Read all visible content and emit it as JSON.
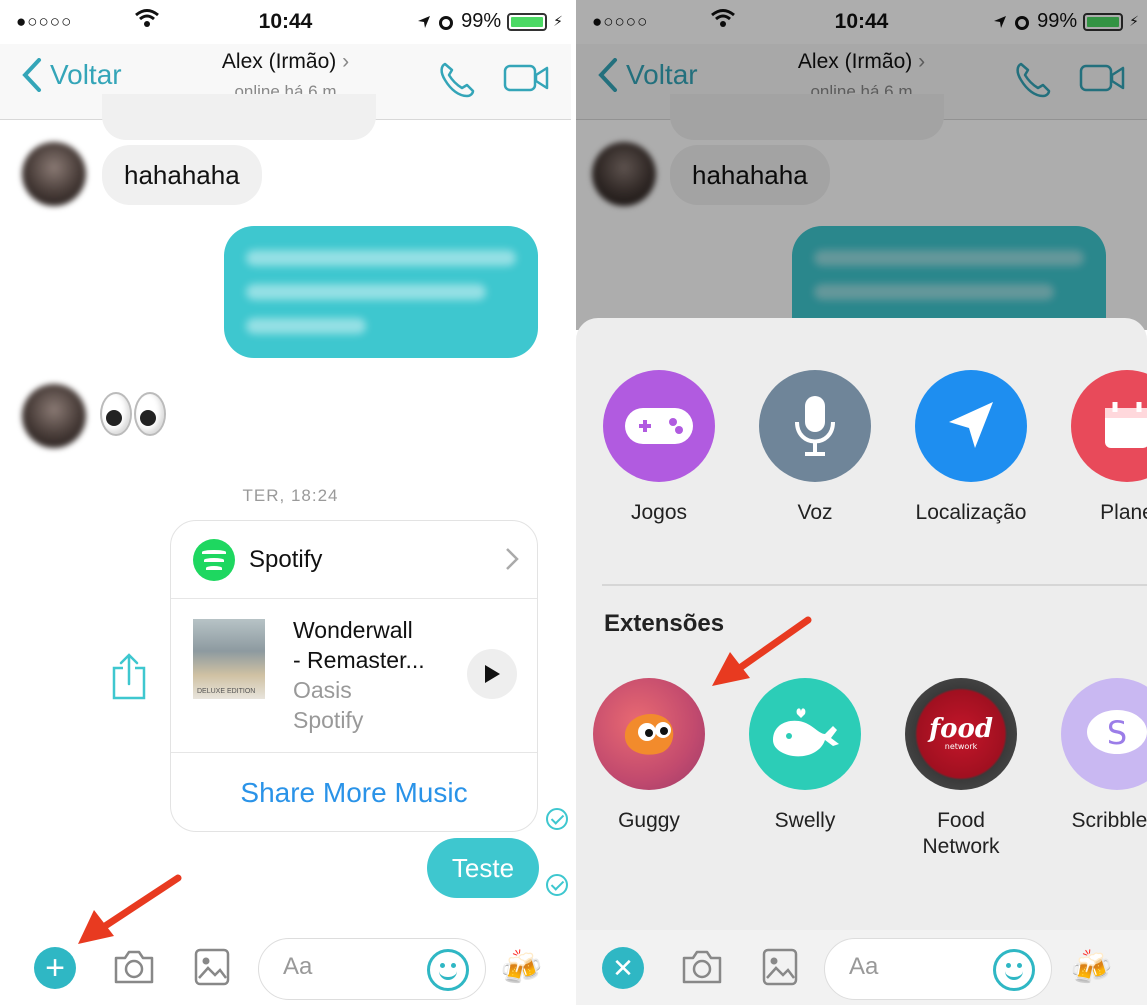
{
  "status": {
    "signal": "●○○○○",
    "time": "10:44",
    "battery": "99%"
  },
  "nav": {
    "back_label": "Voltar",
    "title": "Alex (Irmão)",
    "subtitle": "online há 6 m"
  },
  "messages": {
    "incoming_text": "hahahaha",
    "timestamp": "TER, 18:24"
  },
  "spotify_card": {
    "app_name": "Spotify",
    "track_title_line1": "Wonderwall",
    "track_title_line2": "- Remaster...",
    "artist": "Oasis",
    "source": "Spotify",
    "album_caption": "DELUXE EDITION",
    "action": "Share More Music"
  },
  "outgoing_text": "Teste",
  "composer": {
    "placeholder": "Aa"
  },
  "tray": {
    "apps": [
      {
        "label": "Jogos",
        "icon": "gamepad-icon",
        "color": "#b15be0"
      },
      {
        "label": "Voz",
        "icon": "microphone-icon",
        "color": "#6f8599"
      },
      {
        "label": "Localização",
        "icon": "location-arrow-icon",
        "color": "#1e8ef0"
      },
      {
        "label": "Plane",
        "icon": "calendar-icon",
        "color": "#e84a5a"
      }
    ],
    "extensions_title": "Extensões",
    "extensions": [
      {
        "label": "Guggy",
        "icon": "guggy-icon",
        "color": "#d8566b"
      },
      {
        "label": "Swelly",
        "icon": "whale-icon",
        "color": "#2ccdb7"
      },
      {
        "label": "Food\nNetwork",
        "label_line1": "Food",
        "label_line2": "Network",
        "icon": "food-network-icon",
        "color": "#c4162a"
      },
      {
        "label": "ScribbleC",
        "icon": "scribble-icon",
        "color": "#9b7de8"
      }
    ]
  },
  "colors": {
    "accent": "#34a5b8",
    "outgoing_bubble": "#3ec7cf",
    "link": "#2a93e8",
    "annotation_arrow": "#e83a20"
  }
}
